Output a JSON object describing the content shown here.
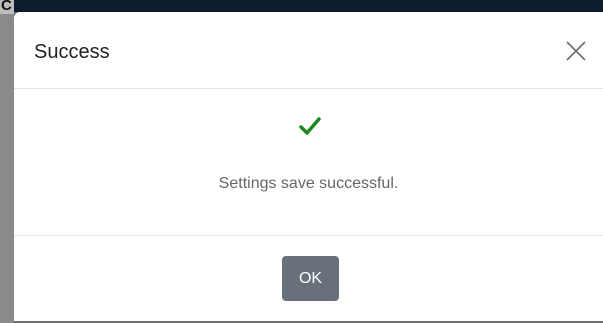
{
  "backdrop": {
    "corner_glyph": "C"
  },
  "dialog": {
    "title": "Success",
    "message": "Settings save successful.",
    "ok_label": "OK",
    "close_icon": "close-icon",
    "status_icon": "checkmark-icon"
  },
  "colors": {
    "success_green": "#1e8a1e",
    "ok_button_bg": "#687079",
    "backdrop_dark": "#0d1b2f"
  }
}
